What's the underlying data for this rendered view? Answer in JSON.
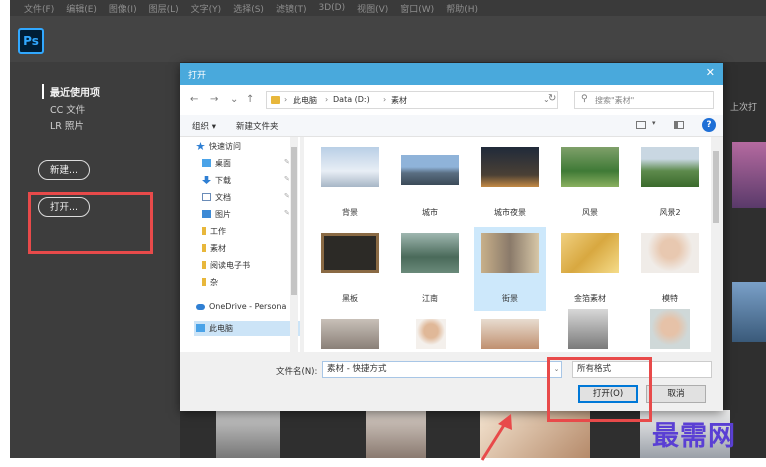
{
  "colors": {
    "ps_bg": "#535353",
    "dialog_title": "#49a9dc",
    "red_highlight": "#e84a4a",
    "watermark": "#5a3fd4"
  },
  "menubar": {
    "items": [
      "文件(F)",
      "编辑(E)",
      "图像(I)",
      "图层(L)",
      "文字(Y)",
      "选择(S)",
      "滤镜(T)",
      "3D(D)",
      "视图(V)",
      "窗口(W)",
      "帮助(H)"
    ]
  },
  "app": {
    "logo": "Ps"
  },
  "sidebar": {
    "recent": "最近使用项",
    "cc_files": "CC 文件",
    "lr_photos": "LR 照片",
    "new_button": "新建...",
    "open_button": "打开..."
  },
  "main": {
    "recent_hint": "上次打"
  },
  "dialog": {
    "title": "打开",
    "close": "✕",
    "nav": {
      "back": "←",
      "forward": "→",
      "down": "⌄",
      "up": "↑",
      "refresh": "↻"
    },
    "breadcrumb": [
      "此电脑",
      "Data (D:)",
      "素材"
    ],
    "search_placeholder": "搜索\"素材\"",
    "toolbar": {
      "organize": "组织 ▾",
      "new_folder": "新建文件夹",
      "help": "?"
    },
    "tree": {
      "quick_access": "快速访问",
      "desktop": "桌面",
      "downloads": "下载",
      "documents": "文档",
      "pictures": "图片",
      "work": "工作",
      "materials": "素材",
      "ebooks": "阅读电子书",
      "misc": "杂",
      "onedrive": "OneDrive - Persona",
      "this_pc": "此电脑"
    },
    "files": [
      "背景",
      "城市",
      "城市夜景",
      "风景",
      "风景2",
      "黑板",
      "江南",
      "街景",
      "金箔素材",
      "模特"
    ],
    "filename_label": "文件名(N):",
    "filename_value": "素材 - 快捷方式",
    "filetype_value": "所有格式",
    "open_button": "打开(O)",
    "cancel_button": "取消"
  },
  "watermark": "最需网"
}
